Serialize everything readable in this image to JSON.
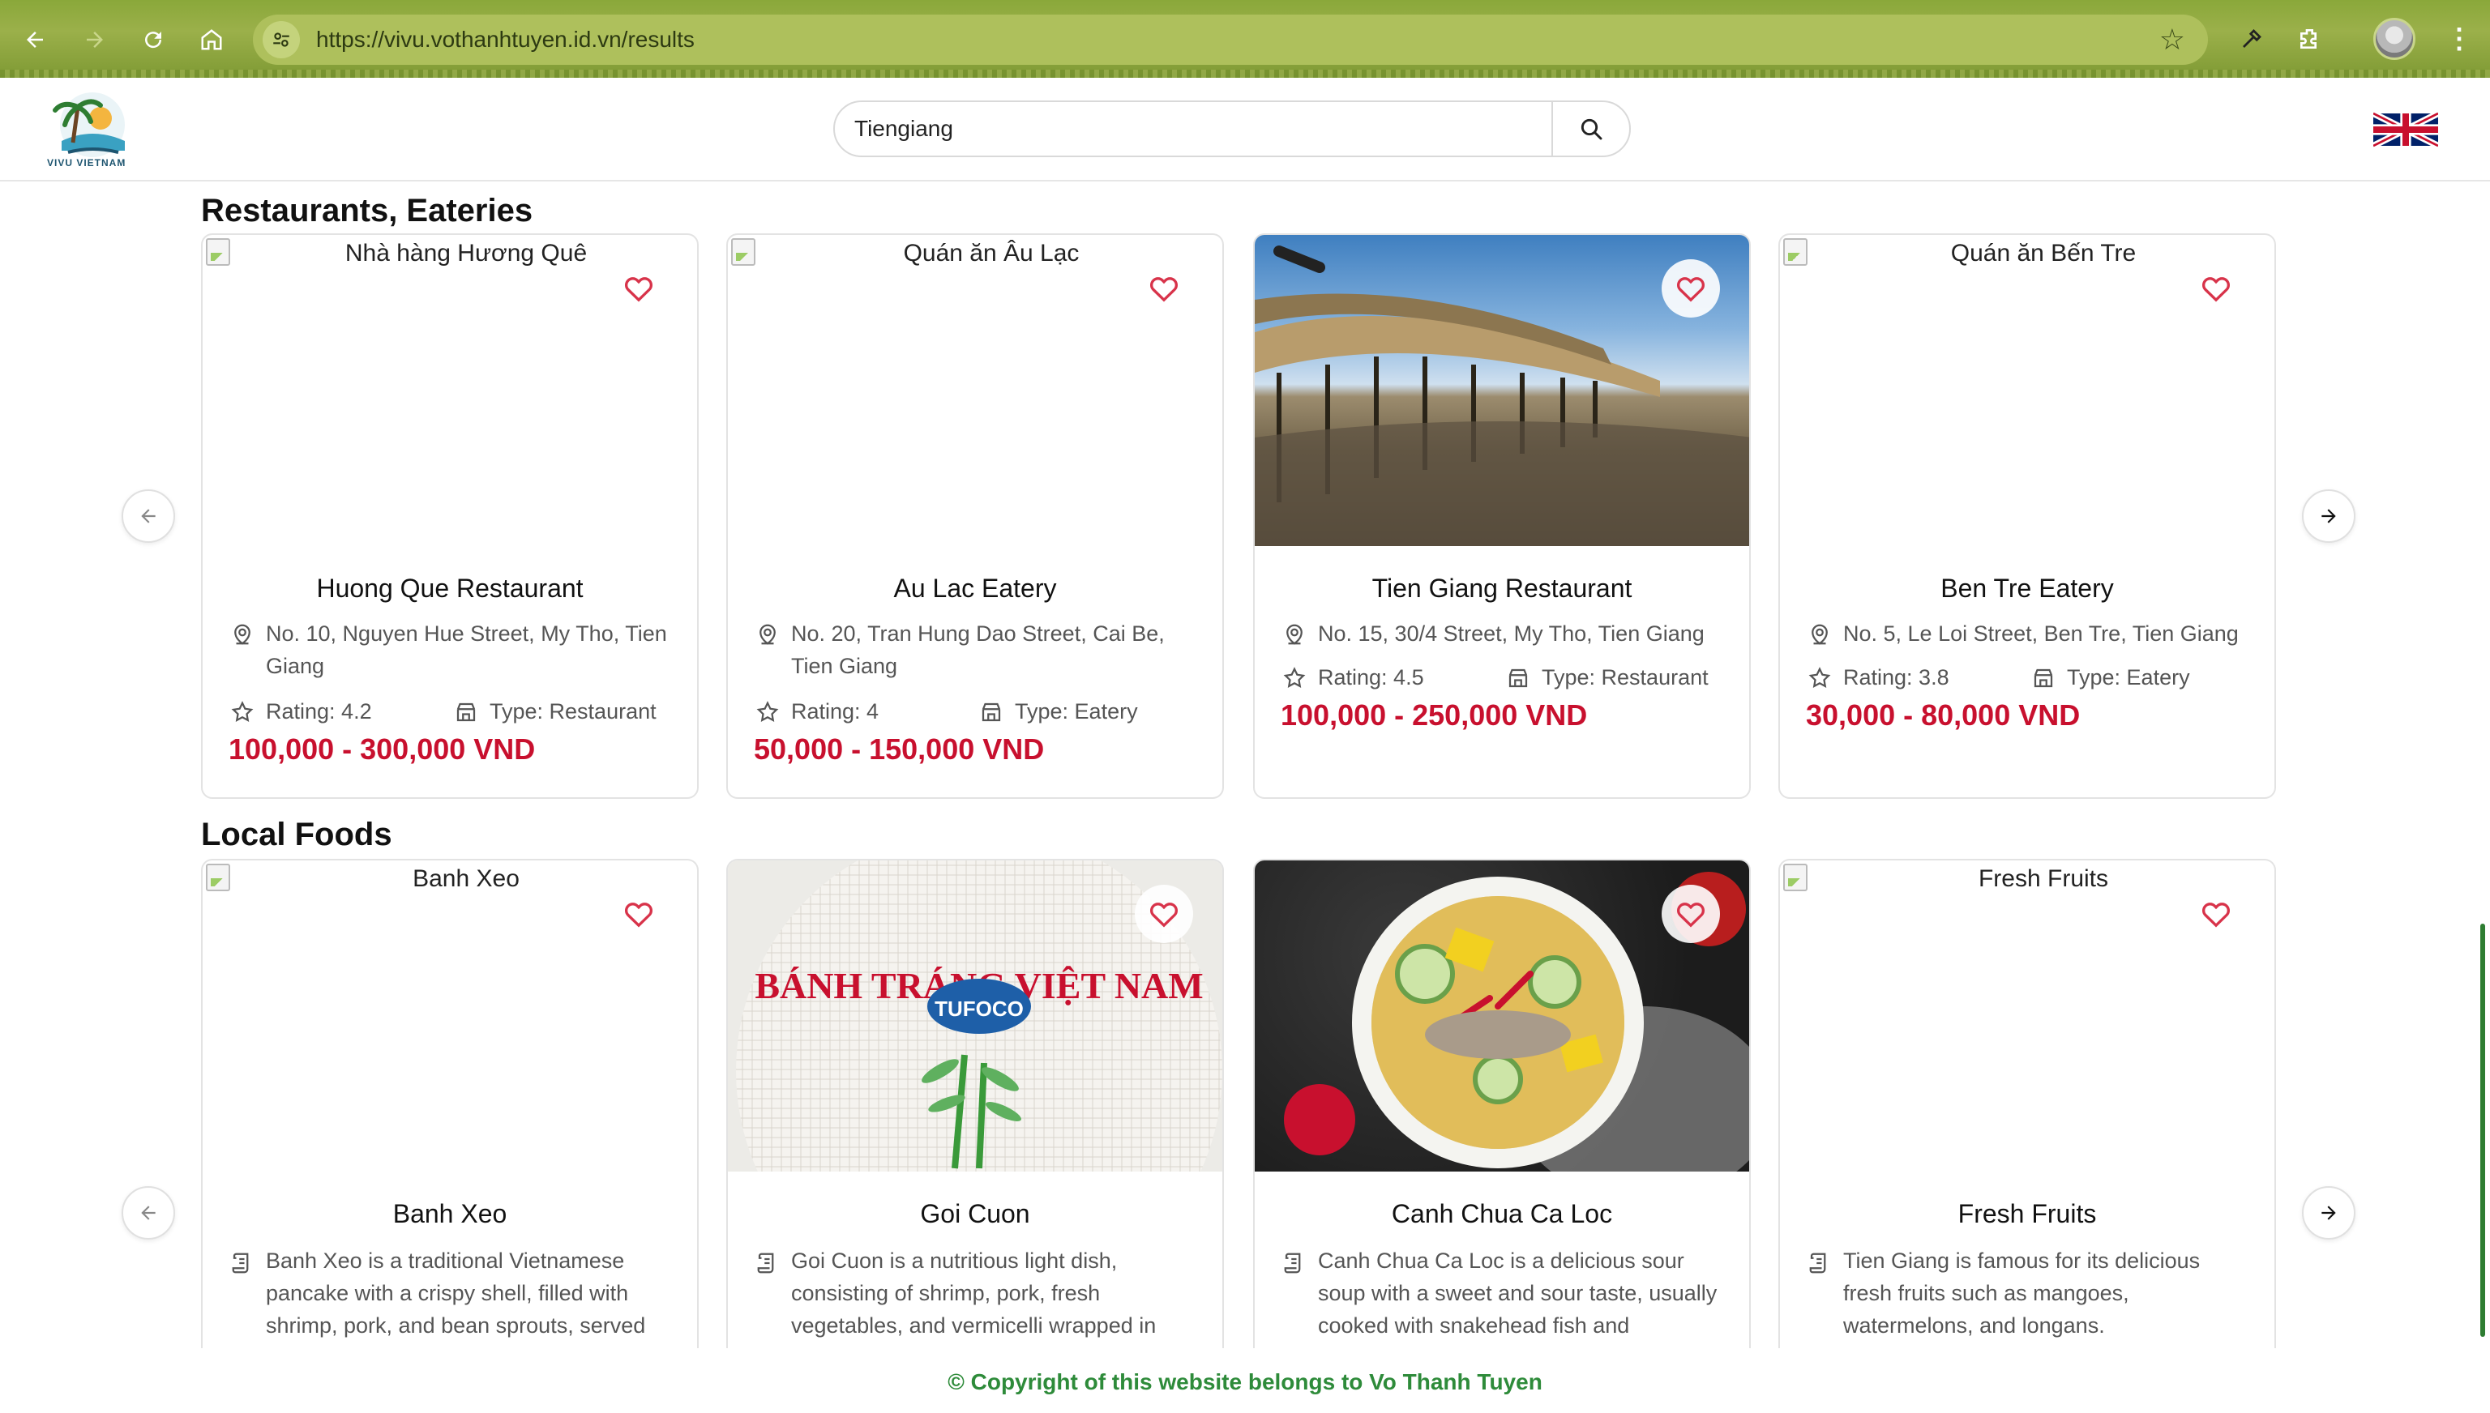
{
  "browser": {
    "url": "https://vivu.vothanhtuyen.id.vn/results"
  },
  "header": {
    "logo_text": "VIVU VIETNAM",
    "search_value": "Tiengiang",
    "language": "English (UK flag)"
  },
  "restaurants": {
    "title": "Restaurants, Eateries",
    "items": [
      {
        "img_alt": "Nhà hàng Hương Quê",
        "name": "Huong Que Restaurant",
        "address": "No. 10, Nguyen Hue Street, My Tho, Tien Giang",
        "rating": "Rating: 4.2",
        "type": "Type: Restaurant",
        "price": "100,000 - 300,000 VND"
      },
      {
        "img_alt": "Quán ăn Âu Lạc",
        "name": "Au Lac Eatery",
        "address": "No. 20, Tran Hung Dao Street, Cai Be, Tien Giang",
        "rating": "Rating: 4",
        "type": "Type: Eatery",
        "price": "50,000 - 150,000 VND"
      },
      {
        "img_alt": "",
        "name": "Tien Giang Restaurant",
        "address": "No. 15, 30/4 Street, My Tho, Tien Giang",
        "rating": "Rating: 4.5",
        "type": "Type: Restaurant",
        "price": "100,000 - 250,000 VND"
      },
      {
        "img_alt": "Quán ăn Bến Tre",
        "name": "Ben Tre Eatery",
        "address": "No. 5, Le Loi Street, Ben Tre, Tien Giang",
        "rating": "Rating: 3.8",
        "type": "Type: Eatery",
        "price": "30,000 - 80,000 VND"
      }
    ]
  },
  "foods": {
    "title": "Local Foods",
    "items": [
      {
        "img_alt": "Banh Xeo",
        "name": "Banh Xeo",
        "desc": "Banh Xeo is a traditional Vietnamese pancake with a crispy shell, filled with shrimp, pork, and bean sprouts, served"
      },
      {
        "img_alt": "",
        "packaging_text": "BÁNH TRÁNG VIỆT NAM",
        "brand_text": "TUFOCO",
        "name": "Goi Cuon",
        "desc": "Goi Cuon is a nutritious light dish, consisting of shrimp, pork, fresh vegetables, and vermicelli wrapped in"
      },
      {
        "img_alt": "",
        "name": "Canh Chua Ca Loc",
        "desc": "Canh Chua Ca Loc is a delicious sour soup with a sweet and sour taste, usually cooked with snakehead fish and"
      },
      {
        "img_alt": "Fresh Fruits",
        "name": "Fresh Fruits",
        "desc": "Tien Giang is famous for its delicious fresh fruits such as mangoes, watermelons, and longans."
      }
    ]
  },
  "footer": {
    "text": "© Copyright of this website belongs to Vo Thanh Tuyen"
  },
  "colors": {
    "price": "#c8102e",
    "heart": "#d8334a",
    "footer": "#2e8b3a",
    "chrome": "#8aa83a"
  }
}
